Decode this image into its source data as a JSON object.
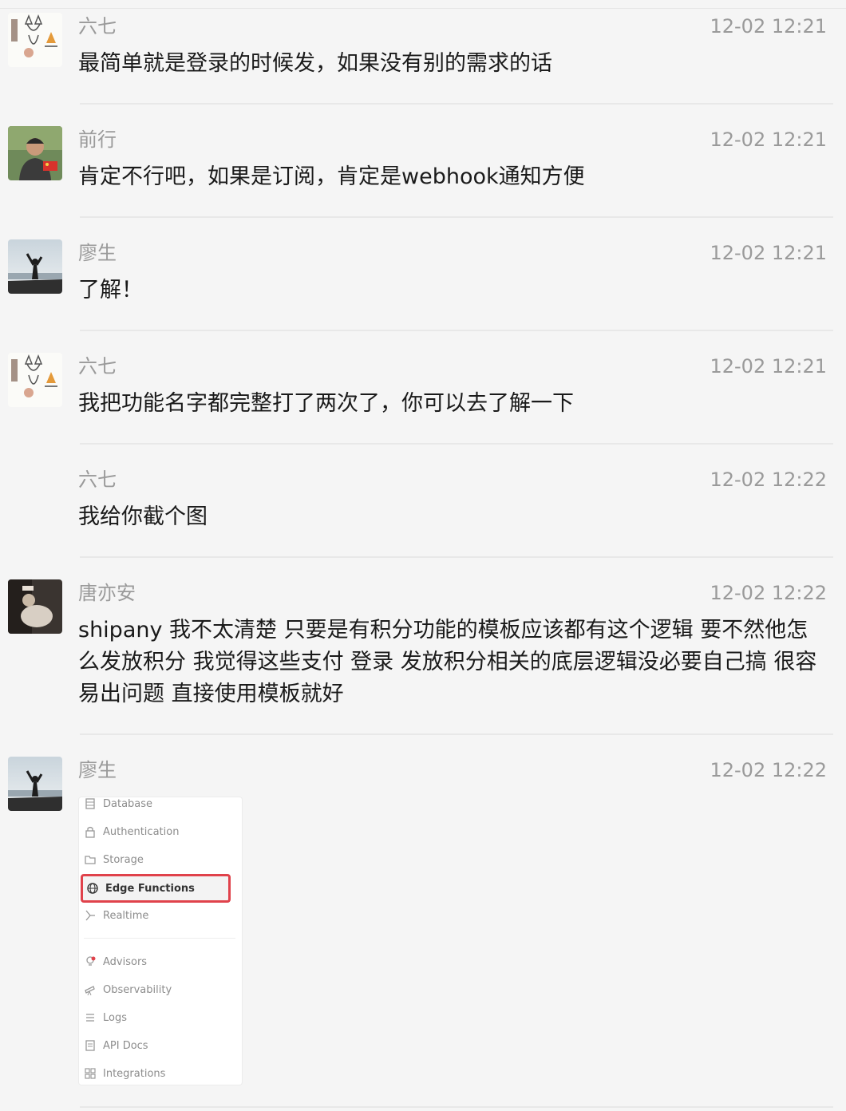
{
  "messages": [
    {
      "name": "六七",
      "time": "12-02 12:21",
      "text": "最简单就是登录的时候发，如果没有别的需求的话",
      "avatar": "dog-sketch-avatar"
    },
    {
      "name": "前行",
      "time": "12-02 12:21",
      "text": "肯定不行吧，如果是订阅，肯定是webhook通知方便",
      "avatar": "man-photo-avatar"
    },
    {
      "name": "廖生",
      "time": "12-02 12:21",
      "text": "了解！",
      "avatar": "silhouette-avatar"
    },
    {
      "name": "六七",
      "time": "12-02 12:21",
      "text": "我把功能名字都完整打了两次了，你可以去了解一下",
      "avatar": "dog-sketch-avatar"
    },
    {
      "name": "六七",
      "time": "12-02 12:22",
      "text": "我给你截个图",
      "avatar": ""
    },
    {
      "name": "唐亦安",
      "time": "12-02 12:22",
      "text": "shipany 我不太清楚 只要是有积分功能的模板应该都有这个逻辑 要不然他怎么发放积分 我觉得这些支付 登录 发放积分相关的底层逻辑没必要自己搞 很容易出问题 直接使用模板就好",
      "avatar": "dark-photo-avatar"
    },
    {
      "name": "廖生",
      "time": "12-02 12:22",
      "text": "",
      "avatar": "silhouette-avatar"
    }
  ],
  "screenshot_menu": {
    "items": [
      {
        "label": "Database",
        "icon": "database-icon"
      },
      {
        "label": "Authentication",
        "icon": "lock-icon"
      },
      {
        "label": "Storage",
        "icon": "folder-icon"
      },
      {
        "label": "Edge Functions",
        "icon": "globe-icon",
        "highlighted": true
      },
      {
        "label": "Realtime",
        "icon": "realtime-icon"
      },
      {
        "label": "Advisors",
        "icon": "lightbulb-icon"
      },
      {
        "label": "Observability",
        "icon": "telescope-icon"
      },
      {
        "label": "Logs",
        "icon": "list-icon"
      },
      {
        "label": "API Docs",
        "icon": "document-icon"
      },
      {
        "label": "Integrations",
        "icon": "grid-icon"
      }
    ],
    "highlight_color": "#e0424b"
  }
}
